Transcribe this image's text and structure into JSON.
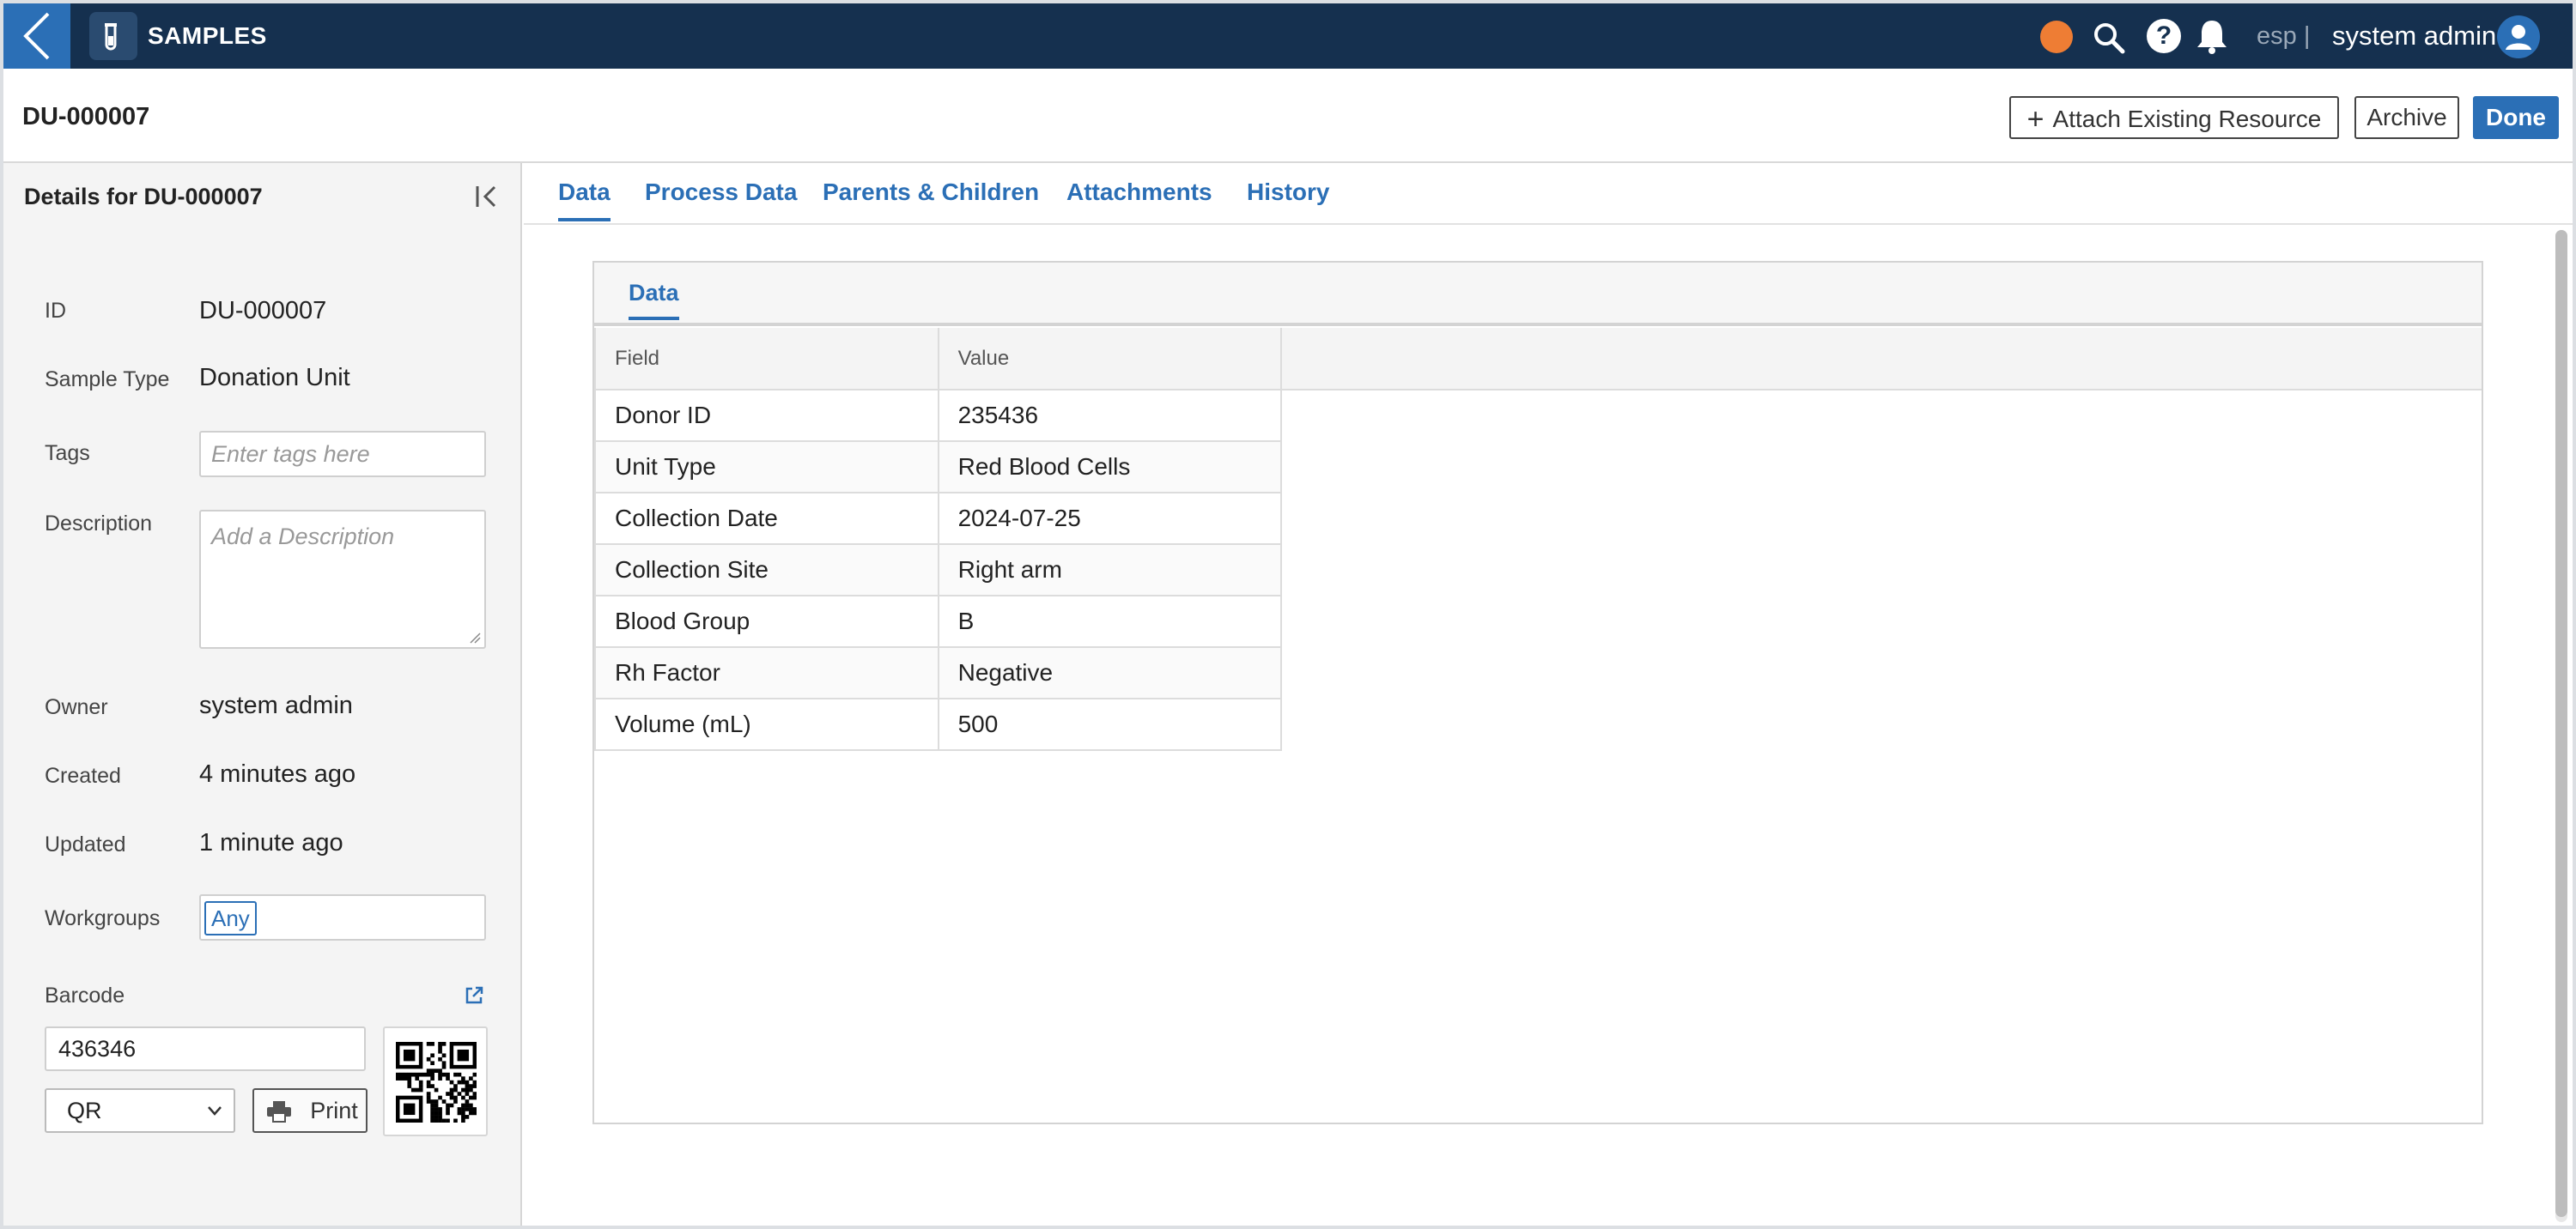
{
  "topbar": {
    "app_title": "SAMPLES",
    "env_label": "esp |",
    "user_name": "system admin",
    "help_glyph": "?",
    "icons": [
      "back-chevron-icon",
      "test-tube-icon",
      "status-dot",
      "search-icon",
      "help-icon",
      "bell-icon",
      "user-avatar-icon"
    ],
    "status_color": "#ee7d34",
    "brand_color": "#15304f",
    "accent_color": "#2b6fb6"
  },
  "header": {
    "title": "DU-000007",
    "attach_plus": "+",
    "attach_label": "Attach Existing Resource",
    "archive_label": "Archive",
    "done_label": "Done"
  },
  "details": {
    "title": "Details for DU-000007",
    "id_label": "ID",
    "id_value": "DU-000007",
    "sample_type_label": "Sample Type",
    "sample_type_value": "Donation Unit",
    "tags_label": "Tags",
    "tags_placeholder": "Enter tags here",
    "description_label": "Description",
    "description_placeholder": "Add a Description",
    "owner_label": "Owner",
    "owner_value": "system admin",
    "created_label": "Created",
    "created_value": "4 minutes ago",
    "updated_label": "Updated",
    "updated_value": "1 minute ago",
    "workgroups_label": "Workgroups",
    "workgroup_chip": "Any",
    "barcode_label": "Barcode",
    "barcode_value": "436346",
    "barcode_type": "QR",
    "print_label": "Print"
  },
  "tabs": [
    {
      "label": "Data",
      "active": true
    },
    {
      "label": "Process Data",
      "active": false
    },
    {
      "label": "Parents & Children",
      "active": false
    },
    {
      "label": "Attachments",
      "active": false
    },
    {
      "label": "History",
      "active": false
    }
  ],
  "data_card": {
    "tab_label": "Data",
    "columns": [
      "Field",
      "Value"
    ],
    "rows": [
      {
        "field": "Donor ID",
        "value": "235436"
      },
      {
        "field": "Unit Type",
        "value": "Red Blood Cells"
      },
      {
        "field": "Collection Date",
        "value": "2024-07-25"
      },
      {
        "field": "Collection Site",
        "value": "Right arm"
      },
      {
        "field": "Blood Group",
        "value": "B"
      },
      {
        "field": "Rh Factor",
        "value": "Negative"
      },
      {
        "field": "Volume (mL)",
        "value": "500"
      }
    ]
  }
}
